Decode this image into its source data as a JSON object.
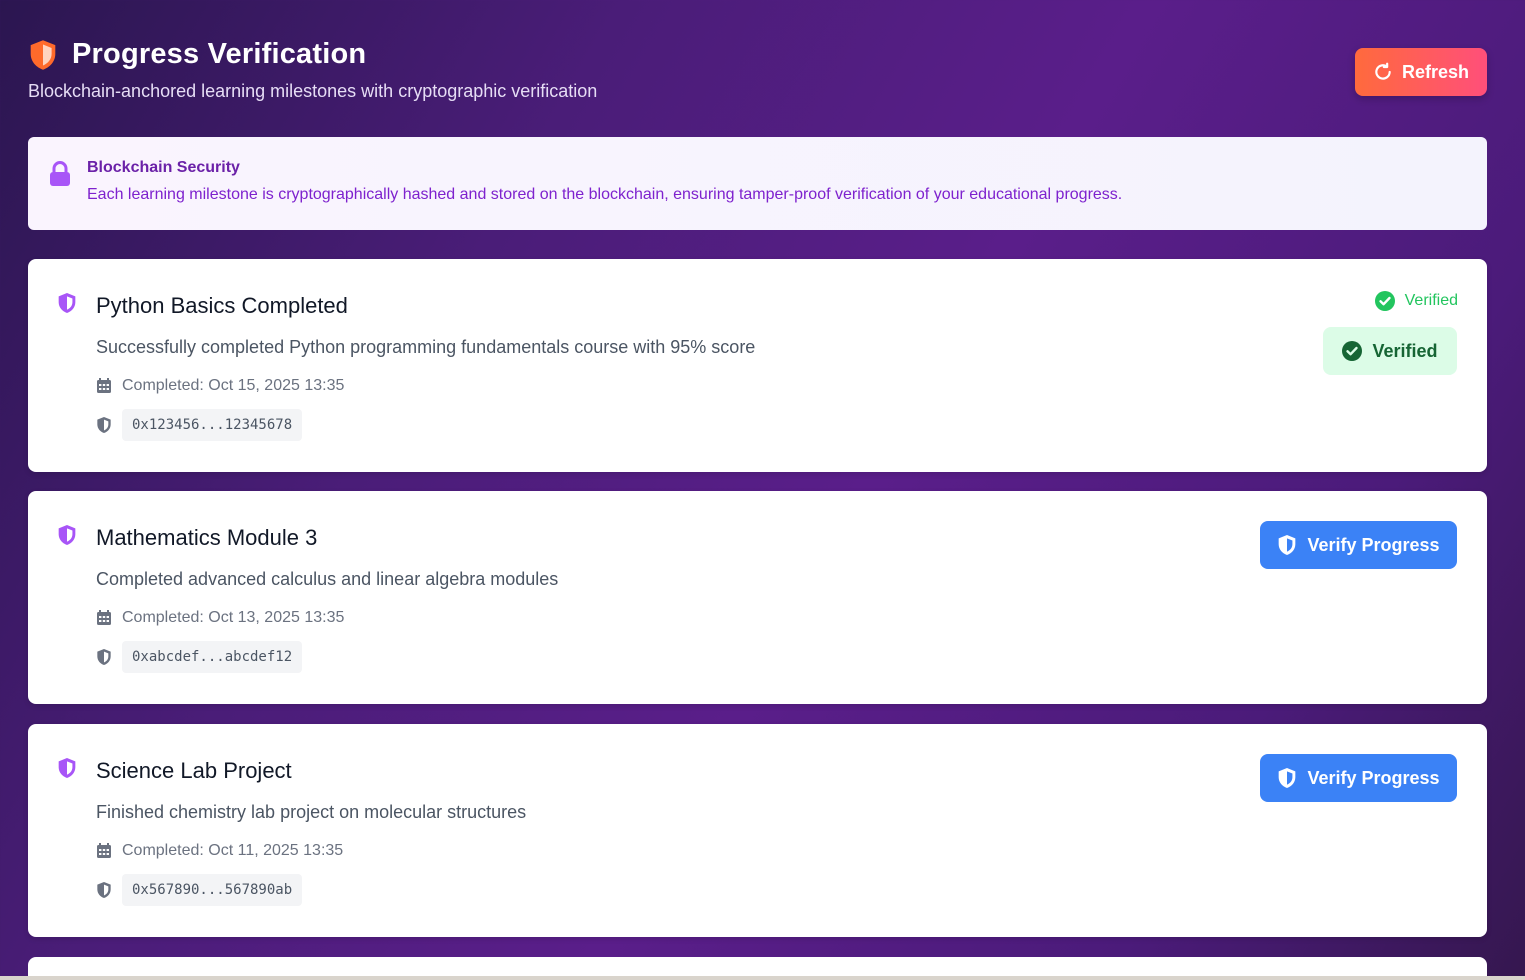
{
  "header": {
    "title": "Progress Verification",
    "subtitle": "Blockchain-anchored learning milestones with cryptographic verification",
    "refresh_label": "Refresh",
    "icon": "shield-icon"
  },
  "security": {
    "title": "Blockchain Security",
    "text": "Each learning milestone is cryptographically hashed and stored on the blockchain, ensuring tamper-proof verification of your educational progress.",
    "icon": "lock-icon"
  },
  "milestones": [
    {
      "title": "Python Basics Completed",
      "description": "Successfully completed Python programming fundamentals course with 95% score",
      "completed": "Completed: Oct 15, 2025 13:35",
      "hash": "0x123456...12345678",
      "status_label": "Verified",
      "badge_label": "Verified"
    },
    {
      "title": "Mathematics Module 3",
      "description": "Completed advanced calculus and linear algebra modules",
      "completed": "Completed: Oct 13, 2025 13:35",
      "hash": "0xabcdef...abcdef12",
      "action_label": "Verify Progress"
    },
    {
      "title": "Science Lab Project",
      "description": "Finished chemistry lab project on molecular structures",
      "completed": "Completed: Oct 11, 2025 13:35",
      "hash": "0x567890...567890ab",
      "action_label": "Verify Progress"
    }
  ],
  "colors": {
    "accent_orange": "#ff6a3d",
    "accent_pink": "#ff4f7a",
    "purple_icon": "#a855f7",
    "verify_blue": "#3b82f6",
    "verified_green": "#22c55e",
    "verified_bg": "#dcfce7"
  }
}
